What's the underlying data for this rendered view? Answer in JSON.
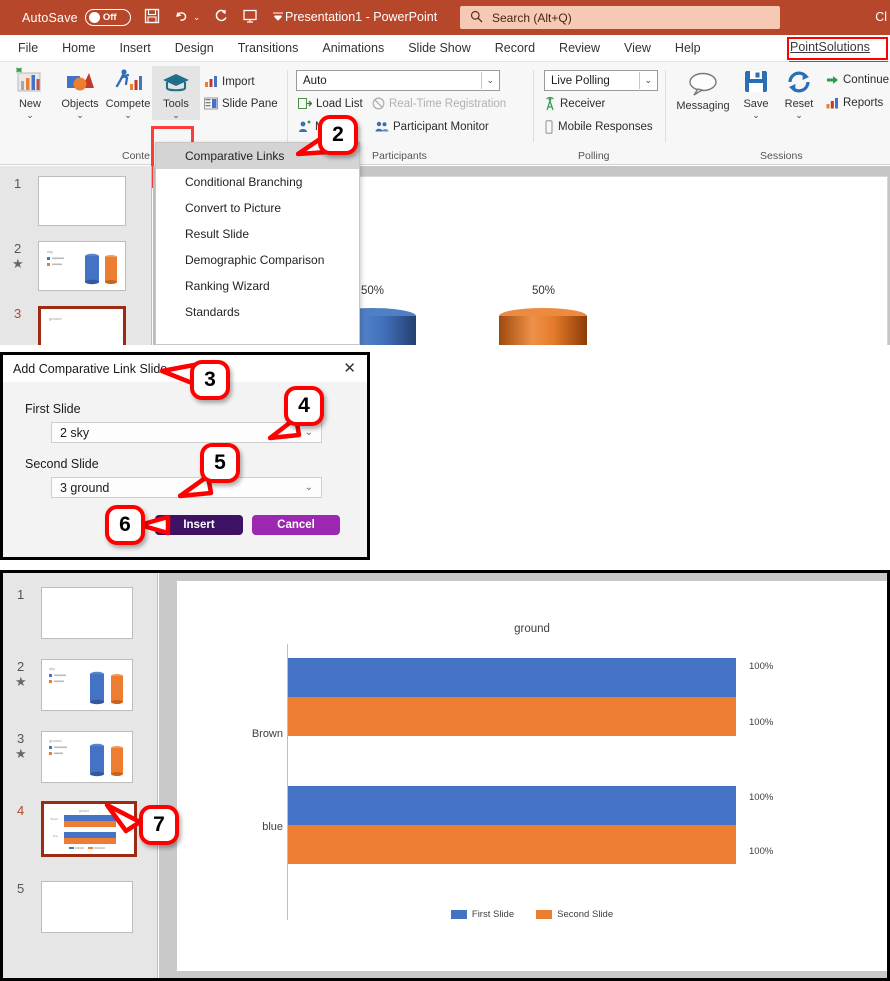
{
  "titlebar": {
    "autosave_label": "AutoSave",
    "autosave_state": "Off",
    "qat": [
      {
        "name": "save-icon",
        "glyph": "ὋE"
      },
      {
        "name": "undo-icon",
        "glyph": "↶"
      },
      {
        "name": "redo-icon",
        "glyph": "↻"
      },
      {
        "name": "start-presentation-icon",
        "glyph": "⧉"
      },
      {
        "name": "customize-quick-access-toolbar-icon",
        "glyph": "⌄"
      }
    ],
    "document_title": "Presentation1  -  PowerPoint",
    "search_placeholder": "Search (Alt+Q)",
    "right_truncated": "Cl"
  },
  "ribbon_tabs": [
    {
      "label": "File"
    },
    {
      "label": "Home"
    },
    {
      "label": "Insert"
    },
    {
      "label": "Design"
    },
    {
      "label": "Transitions"
    },
    {
      "label": "Animations"
    },
    {
      "label": "Slide Show"
    },
    {
      "label": "Record"
    },
    {
      "label": "Review"
    },
    {
      "label": "View"
    },
    {
      "label": "Help"
    }
  ],
  "active_tab": "PointSolutions",
  "ribbon": {
    "groups": [
      {
        "label": "Conte"
      },
      {
        "label": "Participants"
      },
      {
        "label": "Polling"
      },
      {
        "label": "Sessions"
      }
    ],
    "content_group": {
      "new_label": "New",
      "objects_label": "Objects",
      "compete_label": "Compete",
      "tools_label": "Tools",
      "import_label": "Import",
      "slide_pane_label": "Slide Pane"
    },
    "participants_group": {
      "list_value": "Auto",
      "load_list_label": "Load List",
      "real_time_registration_label": "Real-Time Registration",
      "manage_label": "M",
      "participant_monitor_label": "Participant Monitor"
    },
    "polling_group": {
      "mode_value": "Live Polling",
      "receiver_label": "Receiver",
      "mobile_responses_label": "Mobile Responses"
    },
    "sessions_group": {
      "messaging_label": "Messaging",
      "save_label": "Save",
      "reset_label": "Reset",
      "continue_label": "Continue",
      "reports_label": "Reports"
    }
  },
  "tools_menu": {
    "items": [
      {
        "label": "Comparative Links",
        "selected": true
      },
      {
        "label": "Conditional Branching",
        "selected": false
      },
      {
        "label": "Convert to Picture",
        "selected": false
      },
      {
        "label": "Result Slide",
        "selected": false
      },
      {
        "label": "Demographic Comparison",
        "selected": false
      },
      {
        "label": "Ranking Wizard",
        "selected": false
      },
      {
        "label": "Standards",
        "selected": false
      }
    ]
  },
  "slide_panel_top": {
    "slides": [
      {
        "number": "1",
        "starred": false,
        "selected": false
      },
      {
        "number": "2",
        "starred": true,
        "selected": false
      },
      {
        "number": "3",
        "starred": true,
        "selected": true
      }
    ]
  },
  "slide_panel_bottom": {
    "slides": [
      {
        "number": "1",
        "starred": false,
        "selected": false
      },
      {
        "number": "2",
        "starred": true,
        "selected": false
      },
      {
        "number": "3",
        "starred": true,
        "selected": false
      },
      {
        "number": "4",
        "starred": false,
        "selected": true
      },
      {
        "number": "5",
        "starred": false,
        "selected": false
      }
    ]
  },
  "dialog": {
    "title": "Add Comparative Link Slide",
    "close_label": "✕",
    "first_slide_label": "First Slide",
    "first_slide_value": "2 sky",
    "second_slide_label": "Second Slide",
    "second_slide_value": "3 ground",
    "insert_label": "Insert",
    "cancel_label": "Cancel"
  },
  "callouts": [
    {
      "number": "2"
    },
    {
      "number": "3"
    },
    {
      "number": "4"
    },
    {
      "number": "5"
    },
    {
      "number": "6"
    },
    {
      "number": "7"
    }
  ],
  "colors": {
    "series_first": "#4472C4",
    "series_second": "#ED7D31",
    "brand": "#b7472a",
    "callout_red": "#ff0000",
    "selection_red": "#9c2b14",
    "insert_purple": "#3d1163",
    "cancel_purple": "#9c27b0"
  },
  "top_slide_chart": {
    "labels": [
      "50%",
      "50%"
    ]
  },
  "chart_data": {
    "type": "bar",
    "orientation": "horizontal",
    "title": "ground",
    "categories": [
      "Brown",
      "blue"
    ],
    "series": [
      {
        "name": "First Slide",
        "values": [
          100,
          100
        ],
        "color": "#4472C4"
      },
      {
        "name": "Second Slide",
        "values": [
          100,
          100
        ],
        "color": "#ED7D31"
      }
    ],
    "data_labels": [
      "100%",
      "100%",
      "100%",
      "100%"
    ],
    "xlabel": "",
    "ylabel": "",
    "xlim": [
      0,
      100
    ],
    "grid": false,
    "legend_position": "bottom",
    "legend": [
      "First Slide",
      "Second Slide"
    ]
  }
}
